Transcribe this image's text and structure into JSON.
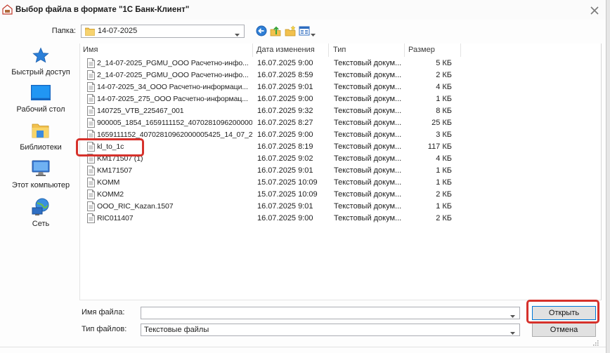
{
  "window": {
    "title": "Выбор файла в формате \"1С Банк-Клиент\""
  },
  "folder": {
    "label": "Папка:",
    "value": "14-07-2025"
  },
  "toolbar": {
    "icons": [
      "back-icon",
      "up-folder-icon",
      "new-folder-icon",
      "view-menu-icon"
    ]
  },
  "places": [
    {
      "label": "Быстрый доступ",
      "icon": "star-icon"
    },
    {
      "label": "Рабочий стол",
      "icon": "desktop-icon"
    },
    {
      "label": "Библиотеки",
      "icon": "libraries-icon"
    },
    {
      "label": "Этот компьютер",
      "icon": "computer-icon"
    },
    {
      "label": "Сеть",
      "icon": "network-icon"
    }
  ],
  "file_list": {
    "columns": [
      "Имя",
      "Дата изменения",
      "Тип",
      "Размер"
    ],
    "rows": [
      {
        "name": "2_14-07-2025_PGMU_ООО Расчетно-инфо...",
        "date": "16.07.2025 9:00",
        "type": "Текстовый докум...",
        "size": "5 КБ"
      },
      {
        "name": "2_14-07-2025_PGMU_ООО Расчетно-инфо...",
        "date": "16.07.2025 8:59",
        "type": "Текстовый докум...",
        "size": "2 КБ"
      },
      {
        "name": "14-07-2025_34_ООО Расчетно-информаци...",
        "date": "16.07.2025 9:01",
        "type": "Текстовый докум...",
        "size": "4 КБ"
      },
      {
        "name": "14-07-2025_275_ООО Расчетно-информац...",
        "date": "16.07.2025 9:00",
        "type": "Текстовый докум...",
        "size": "1 КБ"
      },
      {
        "name": "140725_VTB_225467_001",
        "date": "16.07.2025 9:32",
        "type": "Текстовый докум...",
        "size": "8 КБ"
      },
      {
        "name": "900005_1854_1659111152_40702810962000000...",
        "date": "16.07.2025 8:27",
        "type": "Текстовый докум...",
        "size": "25 КБ"
      },
      {
        "name": "1659111152_40702810962000005425_14_07_2...",
        "date": "16.07.2025 9:00",
        "type": "Текстовый докум...",
        "size": "3 КБ"
      },
      {
        "name": "kl_to_1c",
        "date": "16.07.2025 8:19",
        "type": "Текстовый докум...",
        "size": "117 КБ"
      },
      {
        "name": "KM171507 (1)",
        "date": "16.07.2025 9:02",
        "type": "Текстовый докум...",
        "size": "4 КБ"
      },
      {
        "name": "KM171507",
        "date": "16.07.2025 9:01",
        "type": "Текстовый докум...",
        "size": "1 КБ"
      },
      {
        "name": "KOMM",
        "date": "15.07.2025 10:09",
        "type": "Текстовый докум...",
        "size": "1 КБ"
      },
      {
        "name": "KOMM2",
        "date": "15.07.2025 10:09",
        "type": "Текстовый докум...",
        "size": "2 КБ"
      },
      {
        "name": "OOO_RIC_Kazan.1507",
        "date": "16.07.2025 9:01",
        "type": "Текстовый докум...",
        "size": "1 КБ"
      },
      {
        "name": "RIC011407",
        "date": "16.07.2025 9:00",
        "type": "Текстовый докум...",
        "size": "2 КБ"
      }
    ],
    "highlighted_row_index": 7
  },
  "filename": {
    "label": "Имя файла:",
    "value": ""
  },
  "filetype": {
    "label": "Тип файлов:",
    "value": "Текстовые файлы"
  },
  "buttons": {
    "open": "Открыть",
    "cancel": "Отмена"
  },
  "colors": {
    "annotation": "#d6312b",
    "default_button_border": "#0078d7",
    "folder_yellow": "#f2c14e"
  }
}
